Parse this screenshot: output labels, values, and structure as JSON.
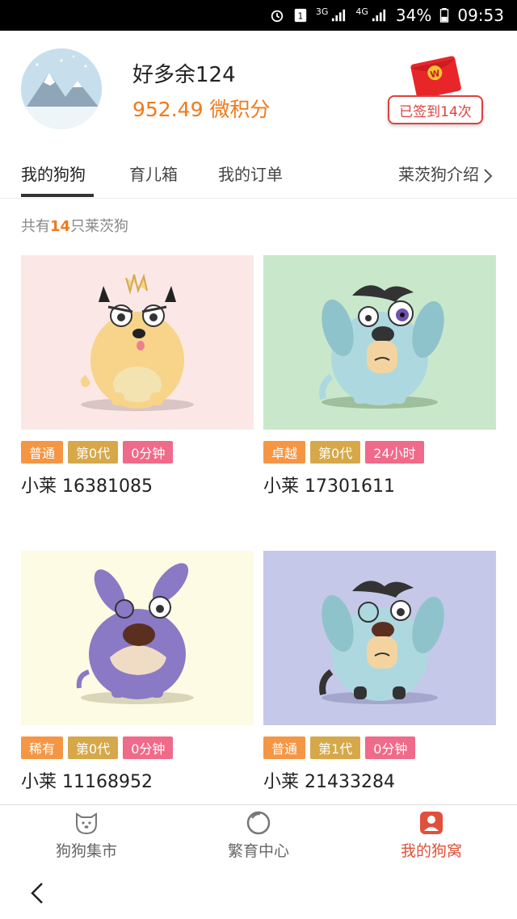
{
  "status_bar": {
    "signal": "3G",
    "signal2": "4G",
    "battery": "34%",
    "time": "09:53"
  },
  "profile": {
    "username": "好多余124",
    "points": "952.49 微积分",
    "checkin_label": "已签到14次",
    "checkin_badge": "W"
  },
  "tabs": [
    {
      "label": "我的狗狗"
    },
    {
      "label": "育儿箱"
    },
    {
      "label": "我的订单"
    },
    {
      "label": "莱茨狗介绍"
    }
  ],
  "count": {
    "prefix": "共有",
    "number": "14",
    "suffix": "只莱茨狗"
  },
  "dogs": [
    {
      "name": "小莱 16381085",
      "rarity": "普通",
      "generation": "第0代",
      "cooldown": "0分钟",
      "bg": "#fbe8e6",
      "rarity_color": "#f59645"
    },
    {
      "name": "小莱 17301611",
      "rarity": "卓越",
      "generation": "第0代",
      "cooldown": "24小时",
      "bg": "#c9e8cb",
      "rarity_color": "#f59645"
    },
    {
      "name": "小莱 11168952",
      "rarity": "稀有",
      "generation": "第0代",
      "cooldown": "0分钟",
      "bg": "#fdfbe4",
      "rarity_color": "#f59645"
    },
    {
      "name": "小莱 21433284",
      "rarity": "普通",
      "generation": "第1代",
      "cooldown": "0分钟",
      "bg": "#c5c8e8",
      "rarity_color": "#f59645"
    }
  ],
  "colors": {
    "accent": "#f07a1a",
    "tag_gen": "#d6a84a",
    "tag_time": "#f06a8a",
    "active_nav": "#e0503a"
  },
  "nav": [
    {
      "label": "狗狗集市",
      "icon": "dog-face-icon"
    },
    {
      "label": "繁育中心",
      "icon": "circle-icon"
    },
    {
      "label": "我的狗窝",
      "icon": "user-badge-icon"
    }
  ]
}
